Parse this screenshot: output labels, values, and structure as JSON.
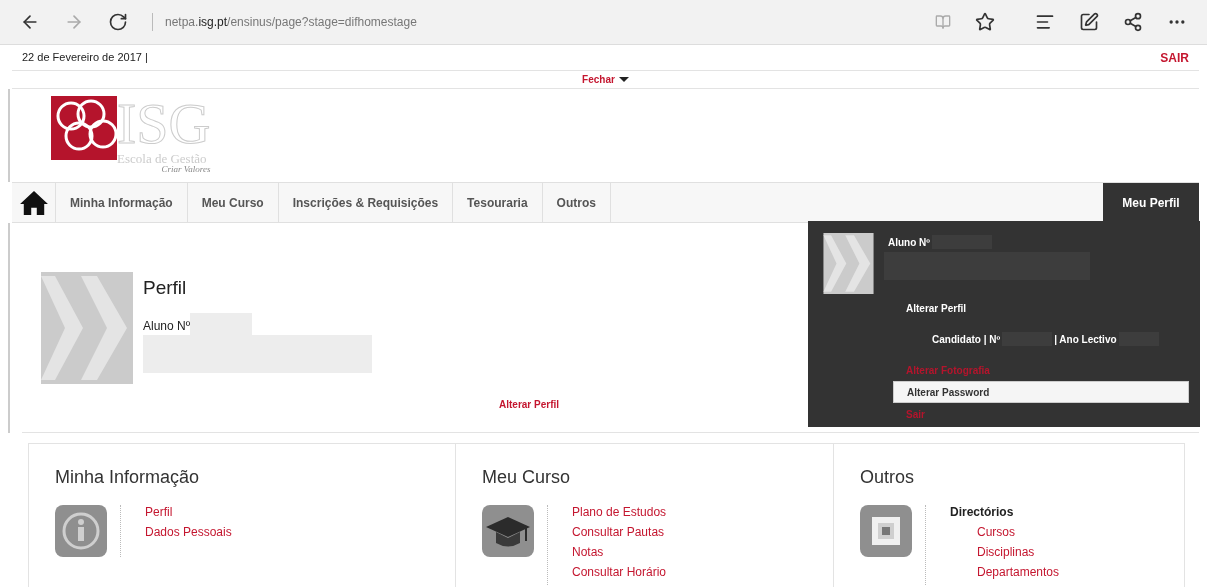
{
  "browser": {
    "url_host": "netpa.",
    "url_domain": "isg.pt",
    "url_path": "/ensinus/page?stage=difhomestage"
  },
  "top_bar": {
    "date": "22 de Fevereiro de 2017 |",
    "logout": "SAIR"
  },
  "collapse": {
    "label": "Fechar"
  },
  "logo": {
    "letters": "ISG",
    "subtitle": "Escola de Gestão",
    "tagline": "Criar Valores"
  },
  "nav": [
    {
      "label": "Minha Informação",
      "selected": false
    },
    {
      "label": "Meu Curso",
      "selected": false
    },
    {
      "label": "Inscrições & Requisições",
      "selected": false
    },
    {
      "label": "Tesouraria",
      "selected": false
    },
    {
      "label": "Outros",
      "selected": false
    }
  ],
  "profile_tab": {
    "label": "Meu Perfil",
    "selected": true
  },
  "profile_menu": {
    "student_label": "Aluno Nº",
    "items": [
      {
        "kind": "heading",
        "label": "Alterar Perfil",
        "selected": false
      },
      {
        "kind": "info",
        "label": "Candidato | Nº",
        "extra": "| Ano Lectivo",
        "selected": false
      },
      {
        "kind": "link",
        "label": "Alterar Fotografia",
        "selected": false
      },
      {
        "kind": "link",
        "label": "Alterar Password",
        "selected": true
      },
      {
        "kind": "link",
        "label": "Sair",
        "selected": false
      }
    ]
  },
  "profile": {
    "title": "Perfil",
    "student_label": "Aluno Nº",
    "edit_link": "Alterar Perfil"
  },
  "sections": [
    {
      "kind": "info",
      "title": "Minha Informação",
      "groups": [
        {
          "links": [
            "Perfil",
            "Dados Pessoais"
          ]
        }
      ]
    },
    {
      "kind": "course",
      "title": "Meu Curso",
      "groups": [
        {
          "links": [
            "Plano de Estudos",
            "Consultar Pautas",
            "Notas",
            "Consultar Horário"
          ]
        }
      ]
    },
    {
      "kind": "other",
      "title": "Outros",
      "groups": [
        {
          "heading": "Directórios",
          "links": [
            "Cursos",
            "Disciplinas",
            "Departamentos"
          ]
        }
      ]
    }
  ]
}
